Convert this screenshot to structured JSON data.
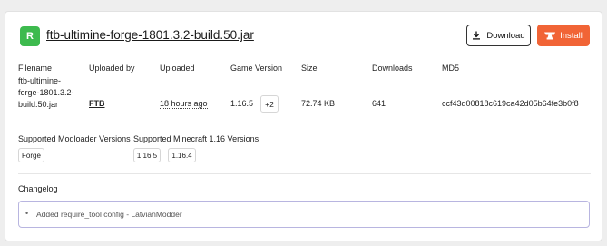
{
  "file": {
    "badge": "R",
    "badge_color": "#3dba4e",
    "title": "ftb-ultimine-forge-1801.3.2-build.50.jar"
  },
  "actions": {
    "download_label": "Download",
    "download_icon": "download-icon",
    "install_label": "Install",
    "install_icon": "curseforge-anvil-icon",
    "install_color": "#f16436"
  },
  "details": {
    "headers": {
      "filename": "Filename",
      "uploaded_by": "Uploaded by",
      "uploaded": "Uploaded",
      "game_version": "Game Version",
      "size": "Size",
      "downloads": "Downloads",
      "md5": "MD5"
    },
    "values": {
      "filename": "ftb-ultimine-forge-1801.3.2-build.50.jar",
      "uploaded_by": "FTB",
      "uploaded": "18 hours ago",
      "game_version": "1.16.5",
      "game_version_more": "+2",
      "size": "72.74 KB",
      "downloads": "641",
      "md5": "ccf43d00818c619ca42d05b64fe3b0f8"
    }
  },
  "support": {
    "modloader_title": "Supported Modloader Versions",
    "modloaders": [
      "Forge"
    ],
    "minecraft_title": "Supported Minecraft 1.16 Versions",
    "minecraft_versions": [
      "1.16.5",
      "1.16.4"
    ]
  },
  "changelog": {
    "title": "Changelog",
    "entries": [
      "Added require_tool config - LatvianModder"
    ]
  }
}
